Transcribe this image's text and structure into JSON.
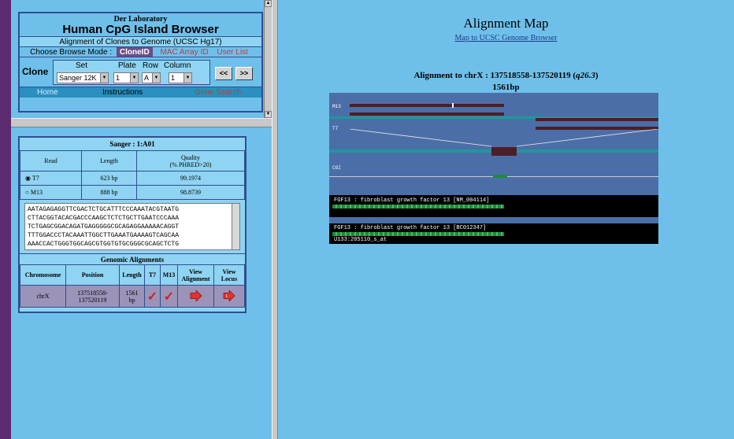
{
  "browser": {
    "lab": "Der Laboratory",
    "title": "Human CpG Island Browser",
    "subtitle": "Alignment of Clones to Genome (UCSC Hg17)",
    "mode_label": "Choose Browse Mode :",
    "modes": [
      "CloneID",
      "MAC Array ID",
      "User List"
    ],
    "clone_label": "Clone",
    "headers": [
      "Set",
      "Plate",
      "Row",
      "Column"
    ],
    "set_value": "Sanger 12K",
    "plate_value": "1",
    "row_value": "A",
    "column_value": "1",
    "prev_label": "<<",
    "next_label": ">>",
    "footer": [
      "Home",
      "Instructions",
      "Gene Search"
    ]
  },
  "clone_detail": {
    "title": "Sanger : 1:A01",
    "headers": [
      "Read",
      "Length",
      "Quality",
      "(% PHRED>20)"
    ],
    "reads": [
      {
        "name": "T7",
        "length": "623 bp",
        "quality": "99.1974",
        "selected": true
      },
      {
        "name": "M13",
        "length": "888 bp",
        "quality": "98.8739",
        "selected": false
      }
    ],
    "sequence_lines": [
      "AATAGAGAGGTTCGACTCTGCATTTCCCAAATACGTAATG",
      "CTTACGGTACACGACCCAAGCTCTCTGCTTGAATCCCAAA",
      "TCTGAGCGGACAGATGAGGGGGCGCAGAGGAAAAACAGGT",
      "TTTGGACCCTACAAATTGGCTTGAAATGAAAAGTCAGCAA",
      "AAACCACTGGGTGGCAGCGTGGTGTGCGGGCGCAGCTCTG"
    ]
  },
  "genomic": {
    "title": "Genomic Alignments",
    "headers": [
      "Chromosome",
      "Position",
      "Length",
      "T7",
      "M13",
      "View",
      "Alignment",
      "View",
      "Locus"
    ],
    "rows": [
      {
        "chromosome": "chrX",
        "position1": "137518558-",
        "position2": "137520119",
        "length1": "1561",
        "length2": "bp"
      }
    ]
  },
  "alignment_map": {
    "title": "Alignment Map",
    "link": "Map to UCSC Genome Browser",
    "caption_prefix": "Alignment to chrX : 137518558-137520119 (",
    "band": "q26.3",
    "caption_suffix": ")",
    "length": "1561bp",
    "track_labels": [
      "M13",
      "T7",
      "CGI"
    ],
    "gene1": "FGF13 : fibroblast growth factor 13 [NM_004114]",
    "gene2": "FGF13 : fibroblast growth factor 13 [BC012347]",
    "probe": "U133:205110_s_at"
  },
  "colors": {
    "background": "#6ec0ea",
    "accent": "#2f4f8f",
    "active_mode": "#6a4d87",
    "map_background": "#4c6ea8",
    "read_bar": "#4b1f25",
    "check": "#c0262a"
  }
}
